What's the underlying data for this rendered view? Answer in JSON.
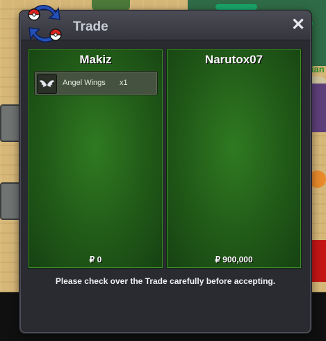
{
  "window": {
    "title": "Trade",
    "close_label": "✕",
    "notice": "Please check over the Trade carefully before accepting."
  },
  "traders": [
    {
      "name": "Makiz",
      "items": [
        {
          "name": "Angel Wings",
          "quantity": "x1",
          "icon": "angel-wings-icon"
        }
      ],
      "money": "₽ 0"
    },
    {
      "name": "Narutox07",
      "items": [],
      "money": "₽ 900,000"
    }
  ],
  "background": {
    "name_fragment": "bian"
  },
  "colors": {
    "panel_green": "#2f7a21",
    "window_bg": "#2a2a31",
    "title_text": "#c9ccd6"
  }
}
